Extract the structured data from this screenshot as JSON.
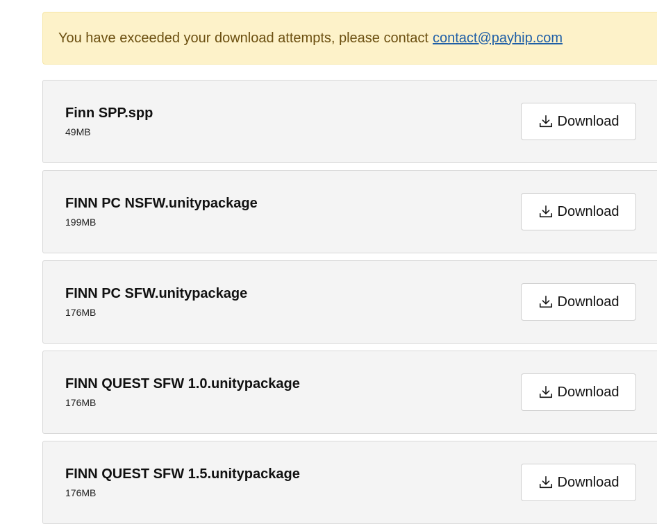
{
  "alert": {
    "message": "You have exceeded your download attempts, please contact",
    "link_text": "contact@payhip.com"
  },
  "files": [
    {
      "name": "Finn SPP.spp",
      "size": "49MB",
      "button_label": "Download",
      "icon": "download-icon"
    },
    {
      "name": "FINN PC NSFW.unitypackage",
      "size": "199MB",
      "button_label": "Download",
      "icon": "download-icon"
    },
    {
      "name": "FINN PC SFW.unitypackage",
      "size": "176MB",
      "button_label": "Download",
      "icon": "download-icon"
    },
    {
      "name": "FINN QUEST SFW 1.0.unitypackage",
      "size": "176MB",
      "button_label": "Download",
      "icon": "download-icon"
    },
    {
      "name": "FINN QUEST SFW 1.5.unitypackage",
      "size": "176MB",
      "button_label": "Download",
      "icon": "download-icon"
    }
  ],
  "colors": {
    "alert_background": "#fdf2c9",
    "alert_text": "#6b4f10",
    "link": "#1f5fa6",
    "row_background": "#f4f4f4"
  }
}
